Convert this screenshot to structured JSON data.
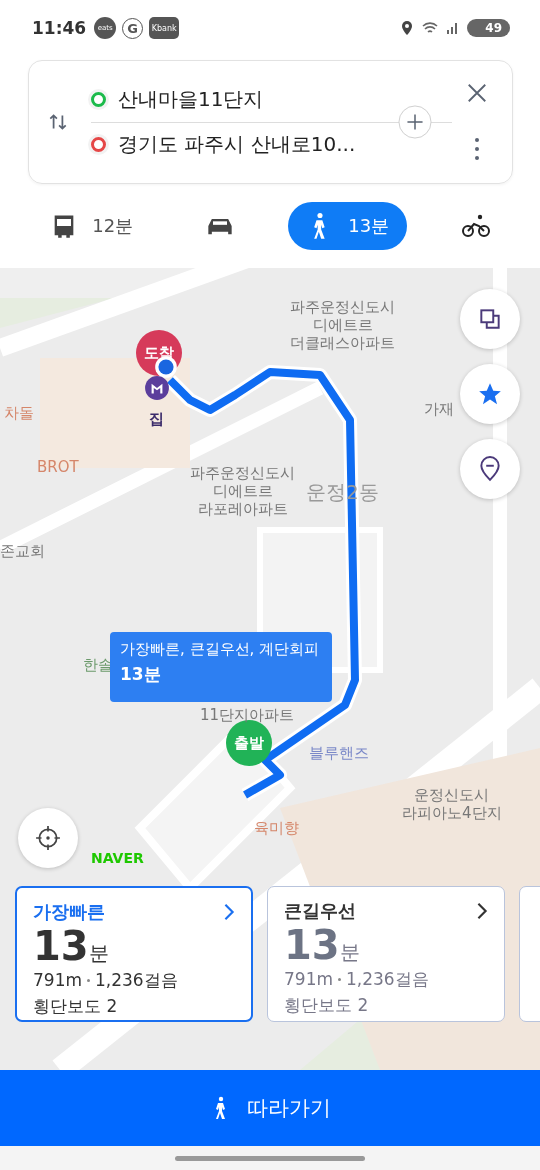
{
  "status_bar": {
    "time": "11:46",
    "apps": [
      "eats",
      "G",
      "Kbank"
    ],
    "battery": "49"
  },
  "route": {
    "origin": "산내마을11단지",
    "destination": "경기도 파주시 산내로10..."
  },
  "modes": [
    {
      "kind": "bus",
      "time": "12분",
      "selected": false
    },
    {
      "kind": "car",
      "selected": false
    },
    {
      "kind": "walk",
      "time": "13분",
      "selected": true
    },
    {
      "kind": "bike",
      "selected": false
    }
  ],
  "map": {
    "arrival_pin": "도착",
    "departure_pin": "출발",
    "home_label": "집",
    "places": [
      "파주운정신도시\n디에트르\n더클래스아파트",
      "차돌",
      "BROT",
      "가재",
      "파주운정신도시\n디에트르\n라포레아파트",
      "운정2동",
      "존교회",
      "한솔",
      "11단지아파트",
      "블루핸즈",
      "육미향",
      "운정신도시\n라피아노4단지"
    ],
    "route_bubble": {
      "tags": "가장빠른, 큰길우선, 계단회피",
      "time": "13분"
    },
    "brand": "NAVER"
  },
  "route_options": [
    {
      "title": "가장빠른",
      "minutes": "13",
      "unit": "분",
      "distance": "791m",
      "steps": "1,236걸음",
      "crossings": "횡단보도 2",
      "selected": true
    },
    {
      "title": "큰길우선",
      "minutes": "13",
      "unit": "분",
      "distance": "791m",
      "steps": "1,236걸음",
      "crossings": "횡단보도 2",
      "selected": false
    }
  ],
  "follow_button": "따라가기"
}
